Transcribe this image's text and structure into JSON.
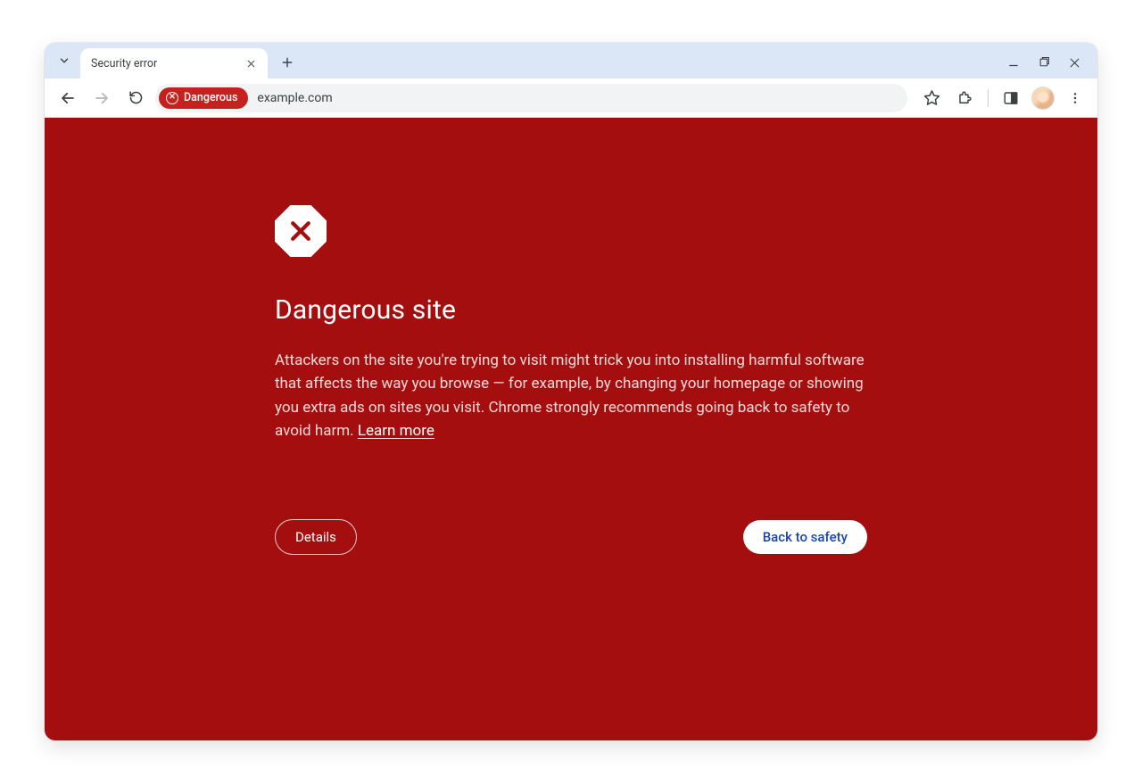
{
  "window": {
    "minimize_label": "Minimize",
    "maximize_label": "Maximize",
    "close_label": "Close"
  },
  "tab": {
    "title": "Security error"
  },
  "omnibox": {
    "chip_label": "Dangerous",
    "url": "example.com"
  },
  "page": {
    "heading": "Dangerous site",
    "body_text": "Attackers on the site you're trying to visit might trick you into installing harmful software that affects the way you browse — for example, by changing your homepage or showing you extra ads on sites you visit. Chrome strongly recommends going back to safety to avoid harm. ",
    "learn_more": "Learn more",
    "details_button": "Details",
    "safety_button": "Back to safety"
  },
  "colors": {
    "page_bg": "#a50e0e",
    "chip_bg": "#c5221f",
    "tab_strip_bg": "#dbe6f7",
    "primary_link": "#1a44b8"
  }
}
